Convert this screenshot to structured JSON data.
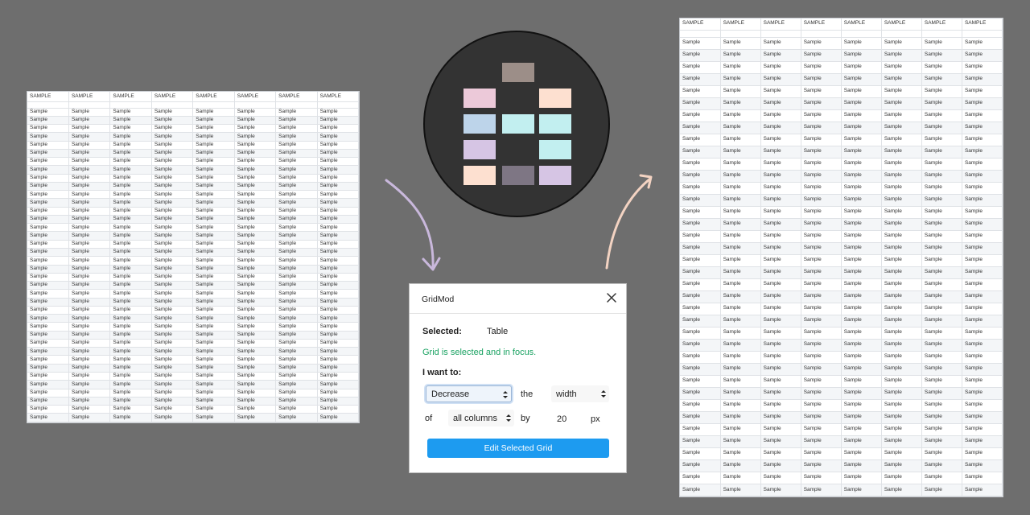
{
  "colors": {
    "background": "#6e6e6e",
    "accent_button": "#1d9bf0",
    "status_green": "#1aa262",
    "arrow_left": "#c9b8dc",
    "arrow_right": "#f3d3c2"
  },
  "left_table": {
    "header_label": "SAMPLE",
    "cell_label": "Sample",
    "columns": 8,
    "body_rows": 38
  },
  "right_table": {
    "header_label": "SAMPLE",
    "cell_label": "Sample",
    "columns": 8,
    "body_rows": 38
  },
  "logo": {
    "name": "gridmod-logo",
    "tile_colors": [
      "#9c8e88",
      "#ecc9d9",
      "#fde0d0",
      "#bdd4ea",
      "#c2eff0",
      "#c2eff0",
      "#d6c5e4",
      "#c2eff0",
      "#fde0d0",
      "#7e7684",
      "#d6c5e4"
    ]
  },
  "dialog": {
    "title": "GridMod",
    "close_icon": "close-icon",
    "selected_label": "Selected:",
    "selected_value": "Table",
    "status": "Grid is selected and in focus.",
    "want_label": "I want to:",
    "action_select": "Decrease",
    "the_label": "the",
    "property_select": "width",
    "of_label": "of",
    "target_select": "all columns",
    "by_label": "by",
    "amount_value": "20",
    "unit_label": "px",
    "button_label": "Edit Selected Grid"
  }
}
